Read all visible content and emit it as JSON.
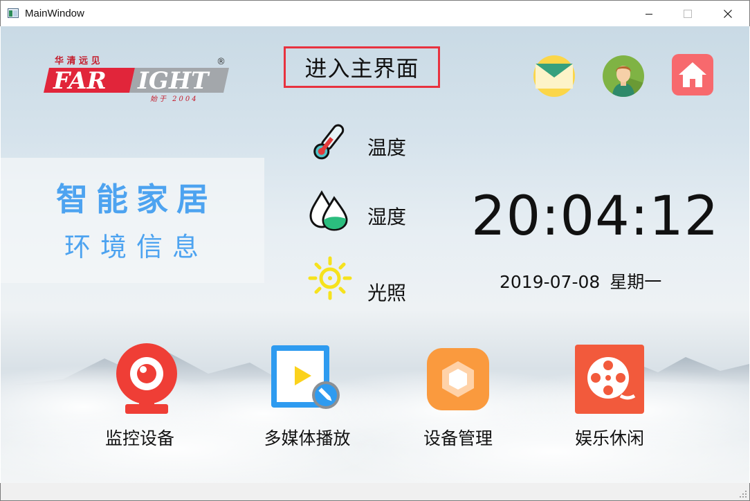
{
  "window": {
    "title": "MainWindow"
  },
  "logo": {
    "chinese": "华 清 远 见",
    "brand_part1": "FAR",
    "brand_part2": "IGHT",
    "registered": "®",
    "founded": "始于 2004"
  },
  "header": {
    "enter_main_label": "进入主界面"
  },
  "panel": {
    "title": "智能家居",
    "subtitle": "环境信息"
  },
  "sensors": [
    {
      "label": "温度",
      "icon": "thermometer-icon"
    },
    {
      "label": "湿度",
      "icon": "humidity-drop-icon"
    },
    {
      "label": "光照",
      "icon": "sun-icon"
    }
  ],
  "clock": {
    "time": "20:04:12",
    "date": "2019-07-08",
    "weekday": "星期一"
  },
  "apps": [
    {
      "label": "监控设备",
      "icon": "webcam-icon"
    },
    {
      "label": "多媒体播放",
      "icon": "media-play-icon"
    },
    {
      "label": "设备管理",
      "icon": "settings-nut-icon"
    },
    {
      "label": "娱乐休闲",
      "icon": "film-reel-icon"
    }
  ],
  "colors": {
    "accent_blue": "#4da3f0",
    "highlight_red": "#e8323f",
    "mail_yellow": "#fbd649",
    "avatar_green": "#7fb344",
    "home_red": "#f7696d",
    "webcam_red": "#ef3e36",
    "media_blue": "#2e9bf0",
    "settings_orange": "#fa9a3e",
    "film_red": "#f25a3c"
  }
}
